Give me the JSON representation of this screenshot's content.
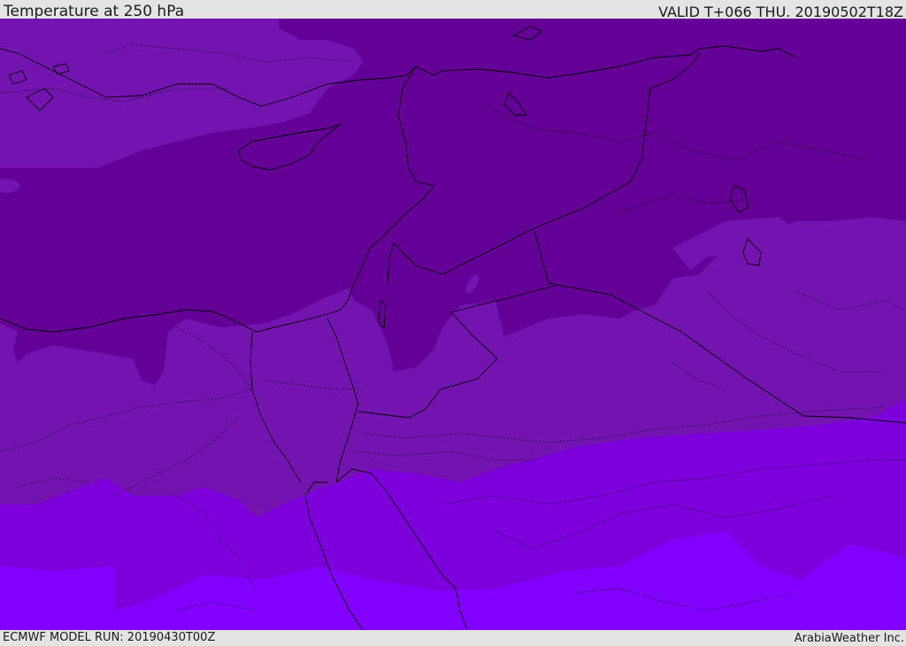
{
  "header": {
    "title": "Temperature at 250 hPa",
    "valid_time": "VALID T+066 THU. 20190502T18Z"
  },
  "footer": {
    "model_run": "ECMWF MODEL RUN: 20190430T00Z",
    "credit": "ArabiaWeather Inc."
  },
  "map": {
    "colors": {
      "band_coldest": "#640096",
      "band_cold": "#7314b0",
      "band_mild": "#7d00dc",
      "band_warm": "#8200ff",
      "coastline": "#000000",
      "borders": "#000000"
    }
  }
}
